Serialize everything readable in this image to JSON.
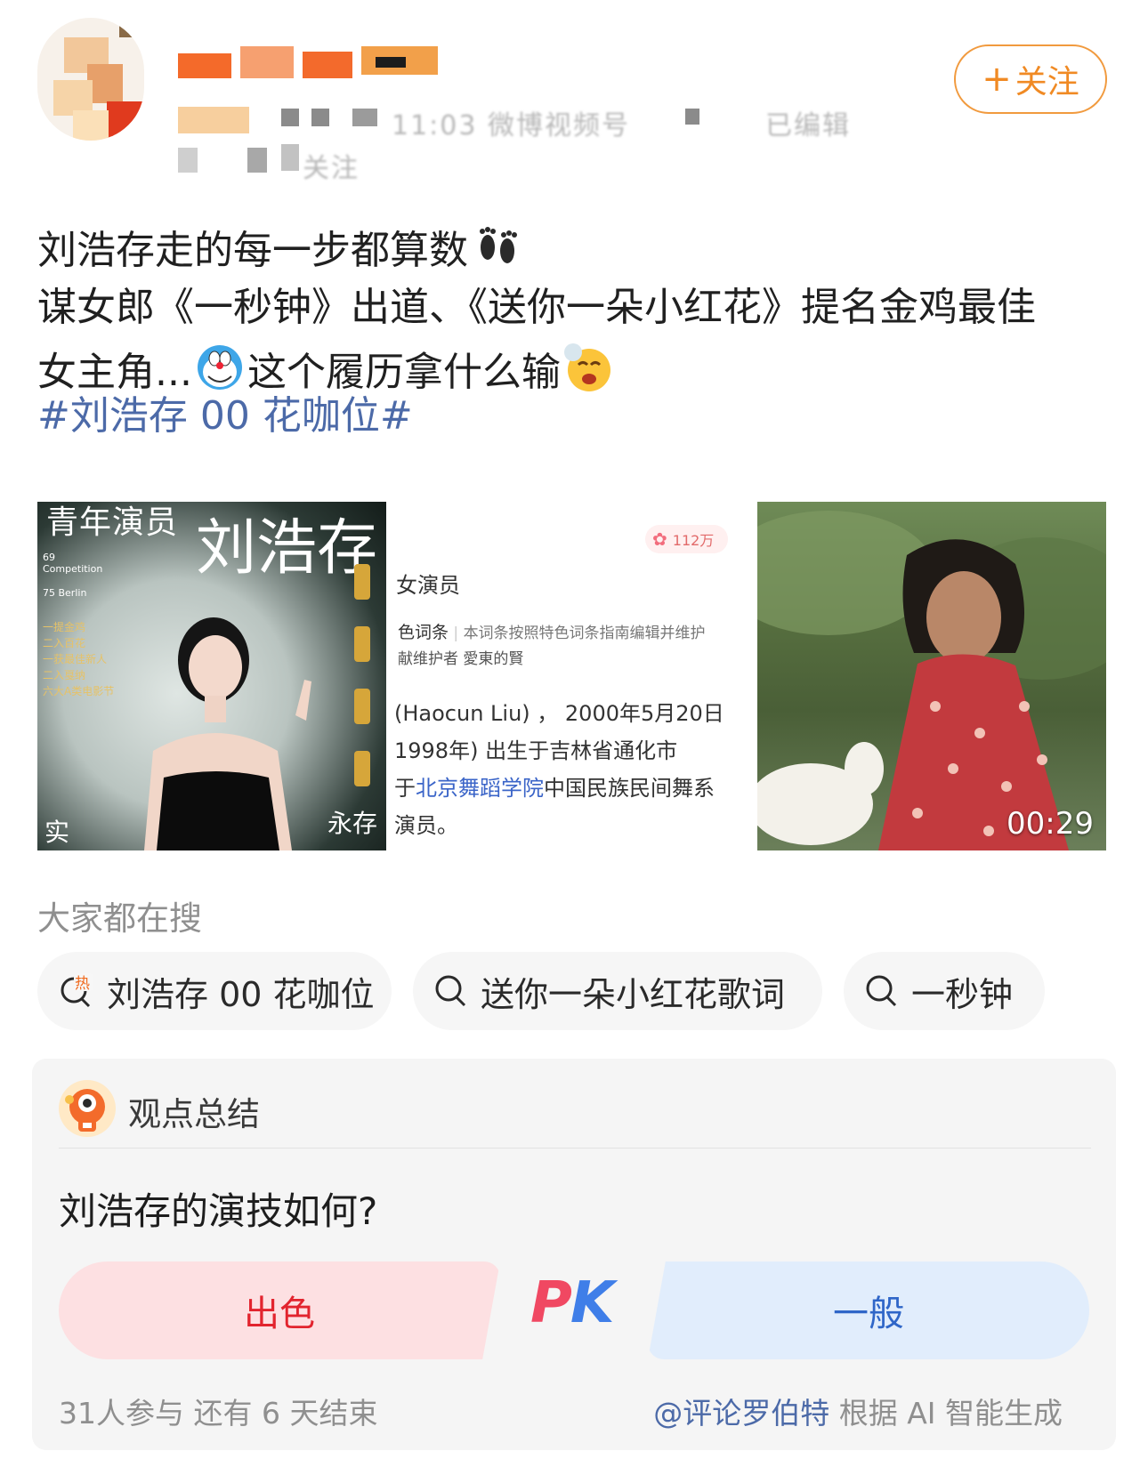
{
  "header": {
    "follow_label": "关注",
    "follow_plus": "+",
    "meta_blurred_1": "11:03  微博视频号",
    "meta_blurred_2": "已编辑",
    "meta_blurred_3": "关注"
  },
  "post": {
    "line1": "刘浩存走的每一步都算数",
    "line2": "谋女郎《一秒钟》出道、《送你一朵小红花》提名金鸡最佳",
    "line3a": "女主角...",
    "line3b": "这个履历拿什么输",
    "hashtag": "#刘浩存 00 花咖位#"
  },
  "images": {
    "poster": {
      "title_small": "青年演员",
      "title_big": "刘浩存",
      "award1": "69 Competition",
      "award2": "75 Berlin",
      "list": [
        "一提金鸡",
        "二入百花",
        "一获最佳新人",
        "二入戛纳",
        "六大A类电影节"
      ],
      "side_right": "永存",
      "side_left": "实"
    },
    "wiki": {
      "badge": "112万",
      "line1": "女演员",
      "line2_label": "色词条",
      "line2_text": "本词条按照特色词条指南编辑并维护",
      "line3": "献维护者 愛東的賢",
      "line4": "(Haocun Liu) ， 2000年5月20日",
      "line5": "1998年",
      "line5b": ") 出生于吉林省通化市",
      "line6a": "于",
      "line6_link": "北京舞蹈学院",
      "line6b": "中国民族民间舞系",
      "line7": "演员。"
    },
    "video": {
      "duration": "00:29"
    }
  },
  "hot_search": {
    "title": "大家都在搜",
    "chips": [
      {
        "label": "刘浩存 00 花咖位",
        "icon": "hot-search-icon"
      },
      {
        "label": "送你一朵小红花歌词",
        "icon": "search-icon"
      },
      {
        "label": "一秒钟",
        "icon": "search-icon"
      }
    ]
  },
  "opinion": {
    "title": "观点总结",
    "question": "刘浩存的演技如何?",
    "option_left": "出色",
    "option_right": "一般",
    "pk_p": "P",
    "pk_k": "K",
    "participants": "31人参与  还有 6 天结束",
    "source_link": "@评论罗伯特",
    "source_text": " 根据 AI 智能生成"
  },
  "colors": {
    "accent_orange": "#f08a24",
    "hashtag_blue": "#4c6aa8",
    "pk_red": "#e2242e",
    "pk_blue": "#2f66c8"
  }
}
